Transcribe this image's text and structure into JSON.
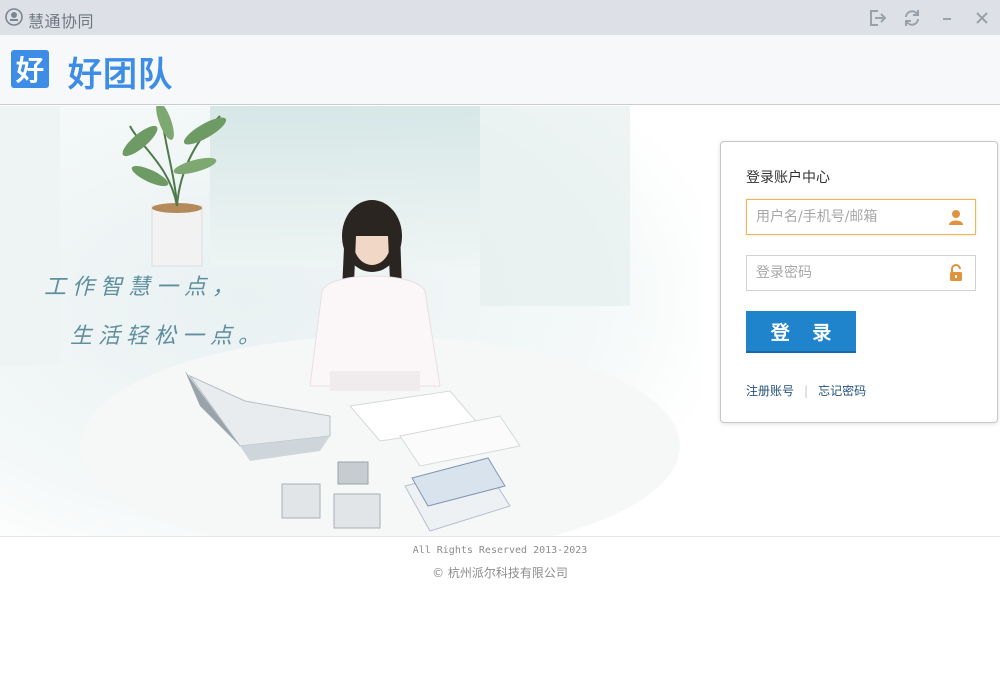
{
  "window": {
    "title": "慧通协同",
    "controls": [
      "logout-icon",
      "refresh-icon",
      "minimize-icon",
      "close-icon"
    ]
  },
  "header": {
    "logo_char": "好",
    "brand": "好团队",
    "brand_color": "#3d8de6"
  },
  "hero": {
    "slogan_line1": "工作智慧一点，",
    "slogan_line2": "生活轻松一点。"
  },
  "login": {
    "title": "登录账户中心",
    "username_placeholder": "用户名/手机号/邮箱",
    "username_icon": "user-icon",
    "password_placeholder": "登录密码",
    "password_icon": "lock-icon",
    "submit_label": "登 录",
    "register_link": "注册账号",
    "forgot_link": "忘记密码",
    "accent_color": "#1f84cc",
    "focus_color": "#f0b55c"
  },
  "footer": {
    "rights": "All Rights Reserved 2013-2023",
    "company": "© 杭州派尔科技有限公司"
  }
}
